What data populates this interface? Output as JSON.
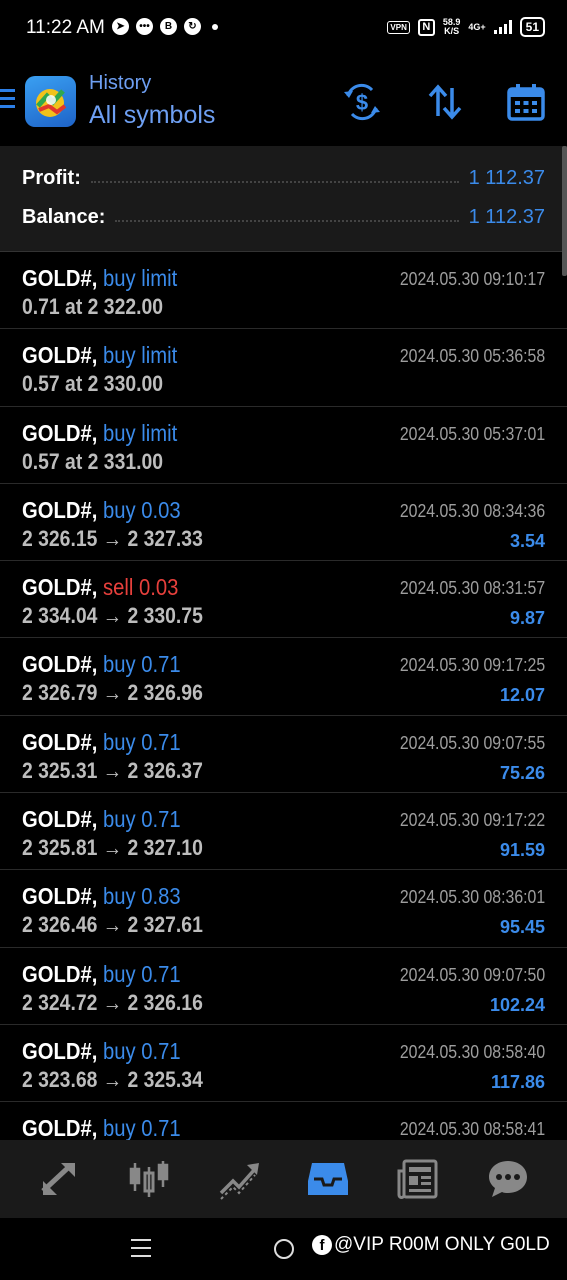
{
  "status_bar": {
    "time": "11:22 AM",
    "vpn": "VPN",
    "nfc": "N",
    "speed_value": "58.9",
    "speed_unit": "K/S",
    "network": "4G+",
    "battery": "51"
  },
  "header": {
    "subtitle": "History",
    "title": "All symbols"
  },
  "summary": {
    "profit_label": "Profit:",
    "profit_value": "1 112.37",
    "balance_label": "Balance:",
    "balance_value": "1 112.37"
  },
  "deals": [
    {
      "symbol": "GOLD#,",
      "type": "buy limit",
      "side": "buy",
      "prices": "0.71 at 2 322.00",
      "time": "2024.05.30 09:10:17",
      "profit": ""
    },
    {
      "symbol": "GOLD#,",
      "type": "buy limit",
      "side": "buy",
      "prices": "0.57 at 2 330.00",
      "time": "2024.05.30 05:36:58",
      "profit": ""
    },
    {
      "symbol": "GOLD#,",
      "type": "buy limit",
      "side": "buy",
      "prices": "0.57 at 2 331.00",
      "time": "2024.05.30 05:37:01",
      "profit": ""
    },
    {
      "symbol": "GOLD#,",
      "type": "buy 0.03",
      "side": "buy",
      "prices": "2 326.15 → 2 327.33",
      "time": "2024.05.30 08:34:36",
      "profit": "3.54"
    },
    {
      "symbol": "GOLD#,",
      "type": "sell 0.03",
      "side": "sell",
      "prices": "2 334.04 → 2 330.75",
      "time": "2024.05.30 08:31:57",
      "profit": "9.87"
    },
    {
      "symbol": "GOLD#,",
      "type": "buy 0.71",
      "side": "buy",
      "prices": "2 326.79 → 2 326.96",
      "time": "2024.05.30 09:17:25",
      "profit": "12.07"
    },
    {
      "symbol": "GOLD#,",
      "type": "buy 0.71",
      "side": "buy",
      "prices": "2 325.31 → 2 326.37",
      "time": "2024.05.30 09:07:55",
      "profit": "75.26"
    },
    {
      "symbol": "GOLD#,",
      "type": "buy 0.71",
      "side": "buy",
      "prices": "2 325.81 → 2 327.10",
      "time": "2024.05.30 09:17:22",
      "profit": "91.59"
    },
    {
      "symbol": "GOLD#,",
      "type": "buy 0.83",
      "side": "buy",
      "prices": "2 326.46 → 2 327.61",
      "time": "2024.05.30 08:36:01",
      "profit": "95.45"
    },
    {
      "symbol": "GOLD#,",
      "type": "buy 0.71",
      "side": "buy",
      "prices": "2 324.72 → 2 326.16",
      "time": "2024.05.30 09:07:50",
      "profit": "102.24"
    },
    {
      "symbol": "GOLD#,",
      "type": "buy 0.71",
      "side": "buy",
      "prices": "2 323.68 → 2 325.34",
      "time": "2024.05.30 08:58:40",
      "profit": "117.86"
    },
    {
      "symbol": "GOLD#,",
      "type": "buy 0.71",
      "side": "buy",
      "prices": "",
      "time": "2024.05.30 08:58:41",
      "profit": ""
    }
  ],
  "tabs": [
    {
      "icon": "quotes-icon",
      "active": false
    },
    {
      "icon": "chart-icon",
      "active": false
    },
    {
      "icon": "trade-icon",
      "active": false
    },
    {
      "icon": "history-icon",
      "active": true
    },
    {
      "icon": "news-icon",
      "active": false
    },
    {
      "icon": "messages-icon",
      "active": false
    }
  ],
  "watermark": "@VIP R00M ONLY G0LD",
  "colors": {
    "accent": "#3b8bea",
    "sell": "#e8403c",
    "header_text": "#6e9ff2"
  }
}
